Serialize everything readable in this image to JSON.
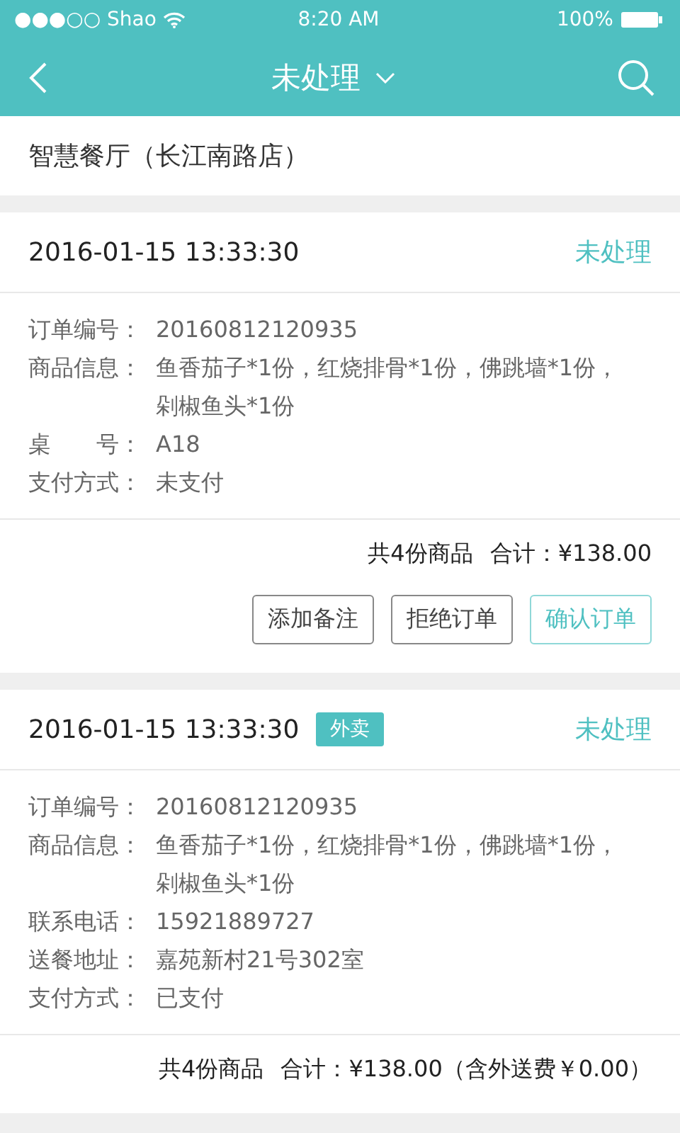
{
  "status_bar": {
    "carrier": "●●●○○ Shao",
    "time": "8:20 AM",
    "battery": "100%"
  },
  "nav": {
    "title": "未处理"
  },
  "shop": {
    "name": "智慧餐厅（长江南路店）"
  },
  "orders": [
    {
      "time": "2016-01-15 13:33:30",
      "status": "未处理",
      "fields": [
        {
          "label": "订单编号：",
          "value": "20160812120935"
        },
        {
          "label": "商品信息：",
          "value": "鱼香茄子*1份，红烧排骨*1份，佛跳墙*1份，剁椒鱼头*1份"
        },
        {
          "label": "桌　　号：",
          "value": "A18"
        },
        {
          "label": "支付方式：",
          "value": "未支付"
        }
      ],
      "count": "共4份商品",
      "total": "合计：¥138.00",
      "buttons": [
        {
          "label": "添加备注",
          "kind": "plain"
        },
        {
          "label": "拒绝订单",
          "kind": "plain"
        },
        {
          "label": "确认订单",
          "kind": "accent"
        }
      ]
    },
    {
      "time": "2016-01-15 13:33:30",
      "tag": "外卖",
      "status": "未处理",
      "fields": [
        {
          "label": "订单编号：",
          "value": "20160812120935"
        },
        {
          "label": "商品信息：",
          "value": "鱼香茄子*1份，红烧排骨*1份，佛跳墙*1份，剁椒鱼头*1份"
        },
        {
          "label": "联系电话：",
          "value": "15921889727"
        },
        {
          "label": "送餐地址：",
          "value": "嘉苑新村21号302室"
        },
        {
          "label": "支付方式：",
          "value": "已支付"
        }
      ],
      "count": "共4份商品",
      "total": "合计：¥138.00（含外送费￥0.00）"
    }
  ]
}
